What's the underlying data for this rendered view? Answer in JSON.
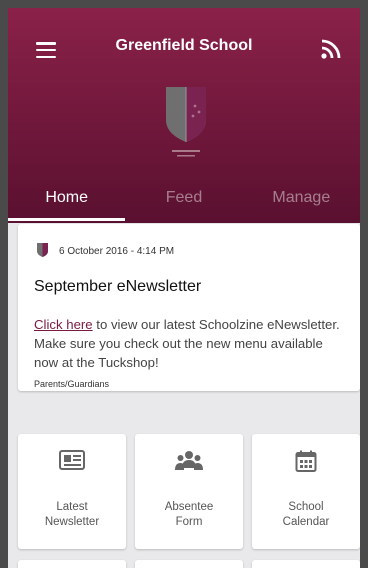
{
  "app": {
    "title": "Greenfield School"
  },
  "tabs": [
    {
      "label": "Home",
      "active": true
    },
    {
      "label": "Feed",
      "active": false
    },
    {
      "label": "Manage",
      "active": false
    }
  ],
  "news": {
    "date": "6 October 2016 - 4:14 PM",
    "title": "September eNewsletter",
    "link_text": "Click here",
    "body_text": " to view our latest Schoolzine eNewsletter. Make sure you check out the new menu available now at the Tuckshop!",
    "audience": "Parents/Guardians"
  },
  "tiles": [
    {
      "icon": "newspaper-icon",
      "line1": "Latest",
      "line2": "Newsletter"
    },
    {
      "icon": "group-icon",
      "line1": "Absentee",
      "line2": "Form"
    },
    {
      "icon": "calendar-icon",
      "line1": "School",
      "line2": "Calendar"
    }
  ],
  "colors": {
    "brand": "#7a1a3f",
    "header_top": "#8a2148",
    "header_bottom": "#5a1030"
  }
}
